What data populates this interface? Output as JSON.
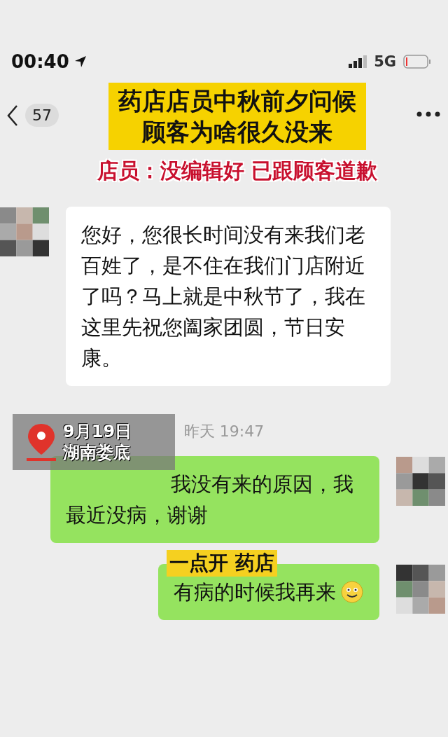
{
  "status_bar": {
    "time": "00:40",
    "network": "5G"
  },
  "header": {
    "unread_count": "57"
  },
  "headline": {
    "lines": [
      "药店店员中秋前夕问候",
      "顾客为啥很久没来"
    ],
    "subtitle": "店员：没编辑好 已跟顾客道歉"
  },
  "messages": [
    {
      "kind": "received",
      "text": "您好，您很长时间没有来我们老百姓了，是不住在我们门店附近了吗？马上就是中秋节了，我在这里先祝您阖家团圆，节日安康。"
    },
    {
      "kind": "time",
      "text": "昨天 19:47"
    },
    {
      "kind": "sent",
      "text": "我没有来的原因，我最近没病，谢谢",
      "emoji": false
    },
    {
      "kind": "sent",
      "text": "有病的时候我再来",
      "emoji": true
    }
  ],
  "location_tag": {
    "date": "9月19日",
    "place": "湖南娄底"
  },
  "caption": "一点开 药店"
}
